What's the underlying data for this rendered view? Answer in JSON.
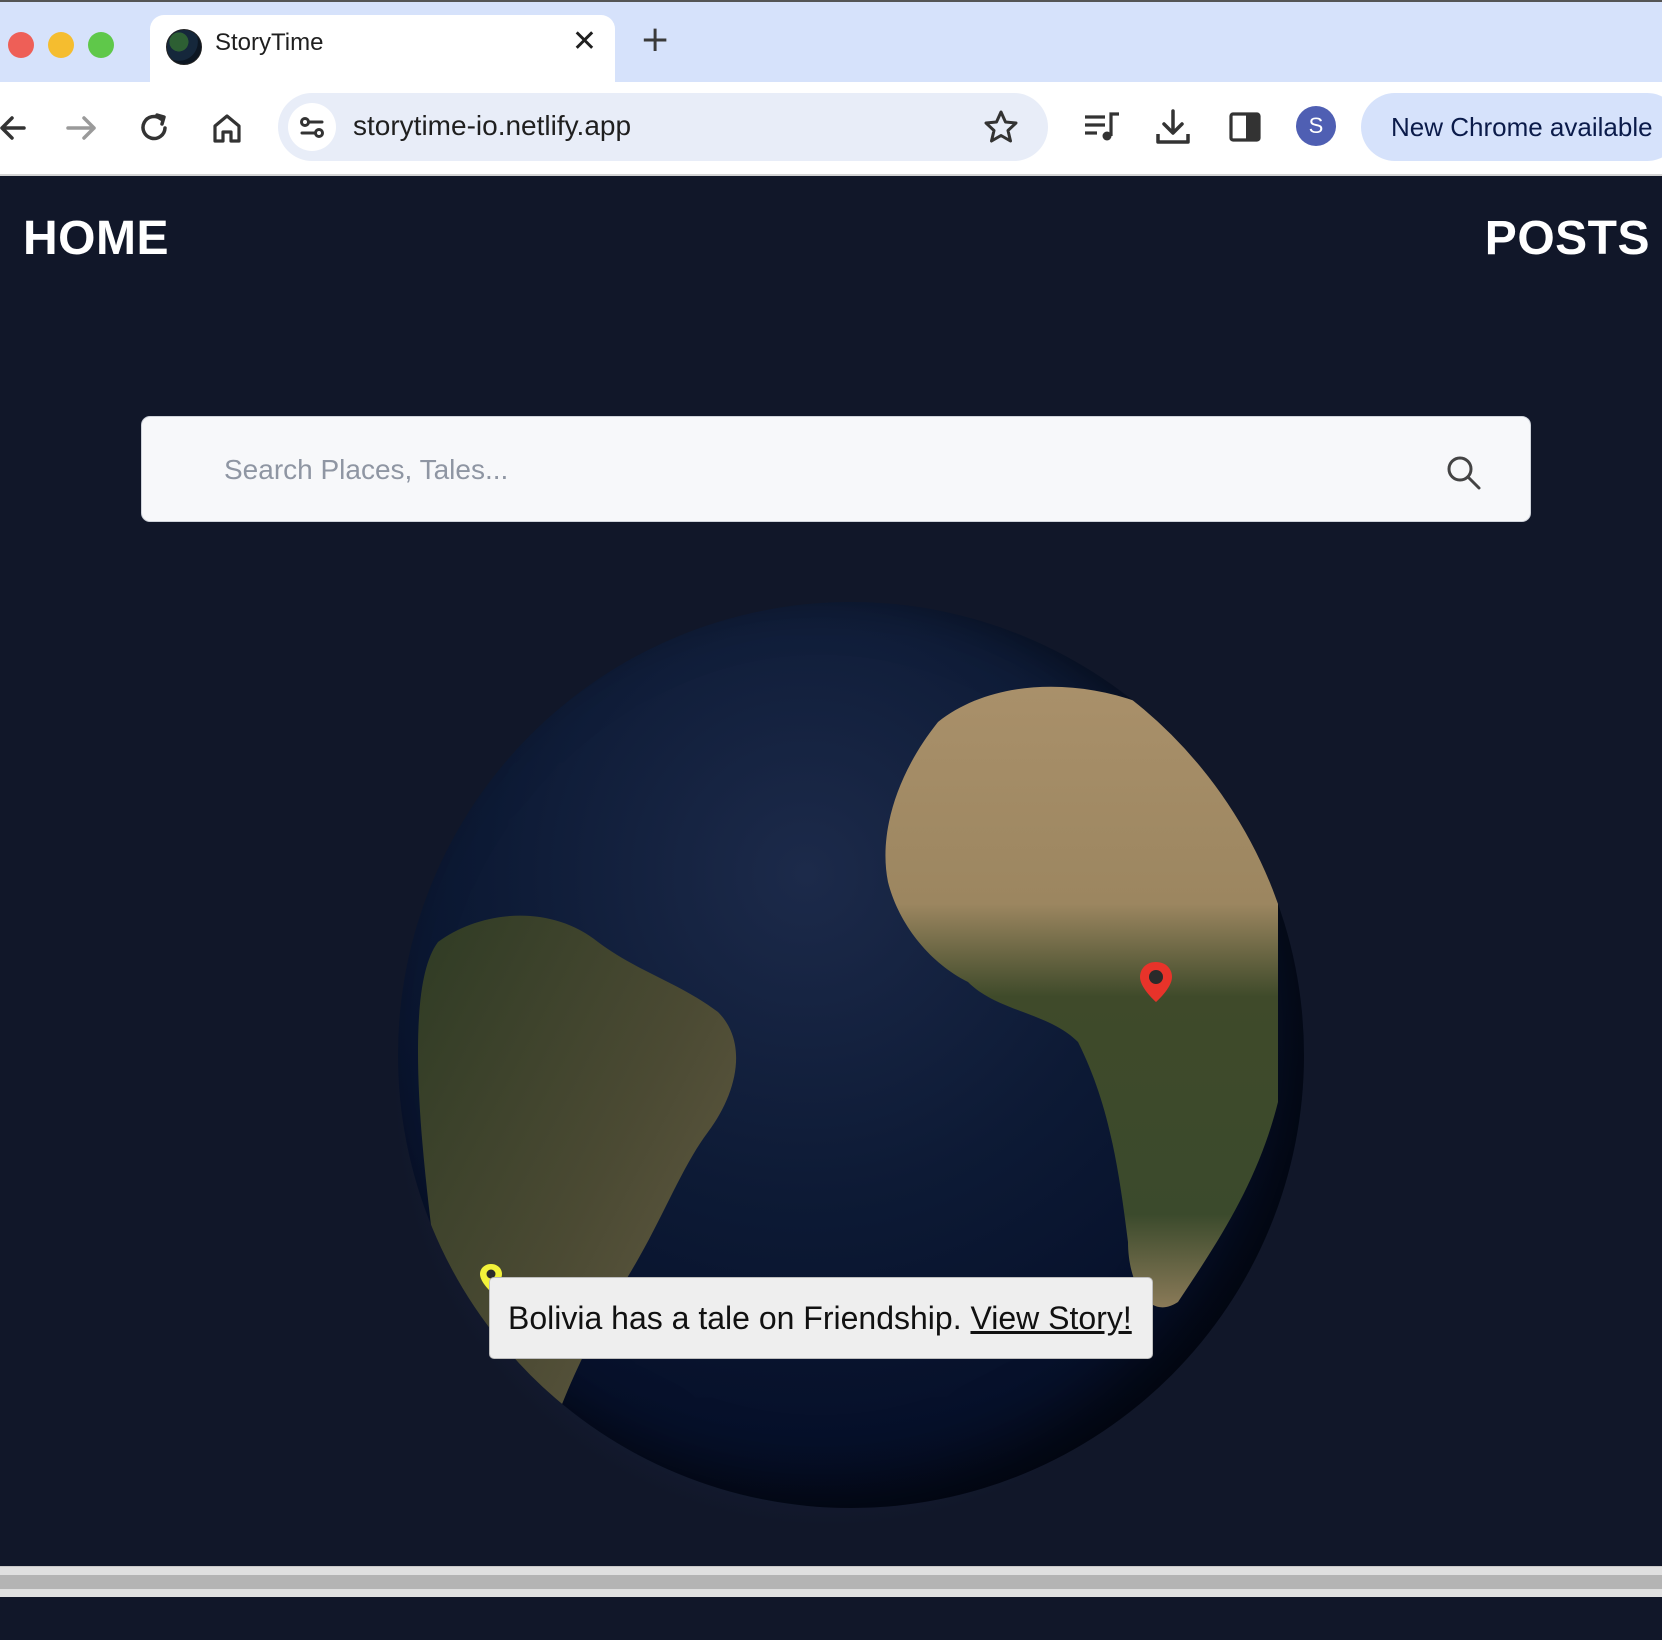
{
  "browser": {
    "tab": {
      "title": "StoryTime",
      "favicon": "globe-icon"
    },
    "new_tab_symbol": "+",
    "close_symbol": "✕",
    "url": "storytime-io.netlify.app",
    "profile_initial": "S",
    "update_label": "New Chrome available"
  },
  "nav": {
    "home_label": "HOME",
    "posts_label": "POSTS"
  },
  "search": {
    "placeholder": "Search Places, Tales...",
    "value": ""
  },
  "globe": {
    "markers": [
      {
        "name": "red-location-pin",
        "color": "#e8332a"
      },
      {
        "name": "yellow-location-pin",
        "color": "#f2f23a"
      }
    ]
  },
  "tooltip": {
    "text": "Bolivia has a tale on Friendship.",
    "link_label": "View Story!"
  }
}
